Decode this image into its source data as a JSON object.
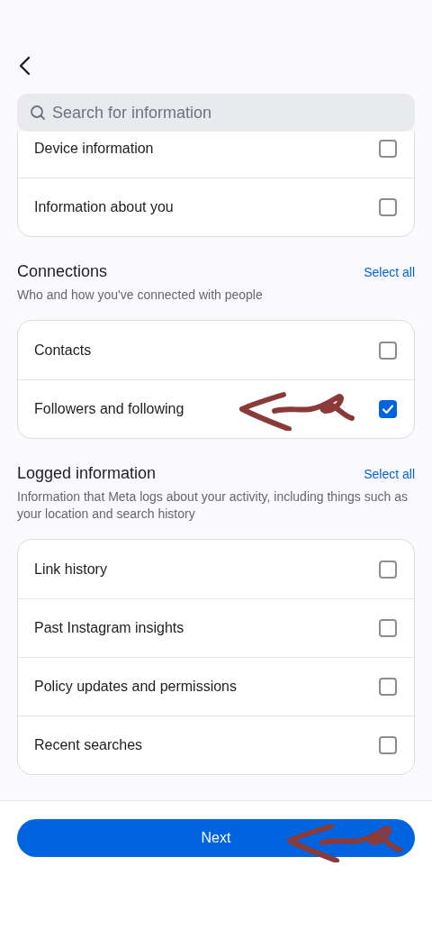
{
  "search": {
    "placeholder": "Search for information"
  },
  "sections": [
    {
      "items": [
        {
          "label": "Device information",
          "checked": false,
          "marked": false
        },
        {
          "label": "Information about you",
          "checked": false,
          "marked": false
        }
      ]
    },
    {
      "title": "Connections",
      "action": "Select all",
      "subtitle": "Who and how you've connected with people",
      "items": [
        {
          "label": "Contacts",
          "checked": false,
          "marked": false
        },
        {
          "label": "Followers and following",
          "checked": true,
          "marked": true
        }
      ]
    },
    {
      "title": "Logged information",
      "action": "Select all",
      "subtitle": "Information that Meta logs about your activity, including things such as your location and search history",
      "items": [
        {
          "label": "Link history",
          "checked": false,
          "marked": false
        },
        {
          "label": "Past Instagram insights",
          "checked": false,
          "marked": false
        },
        {
          "label": "Policy updates and permissions",
          "checked": false,
          "marked": false
        },
        {
          "label": "Recent searches",
          "checked": false,
          "marked": false
        }
      ]
    }
  ],
  "next_button": {
    "label": "Next",
    "marked": true
  }
}
